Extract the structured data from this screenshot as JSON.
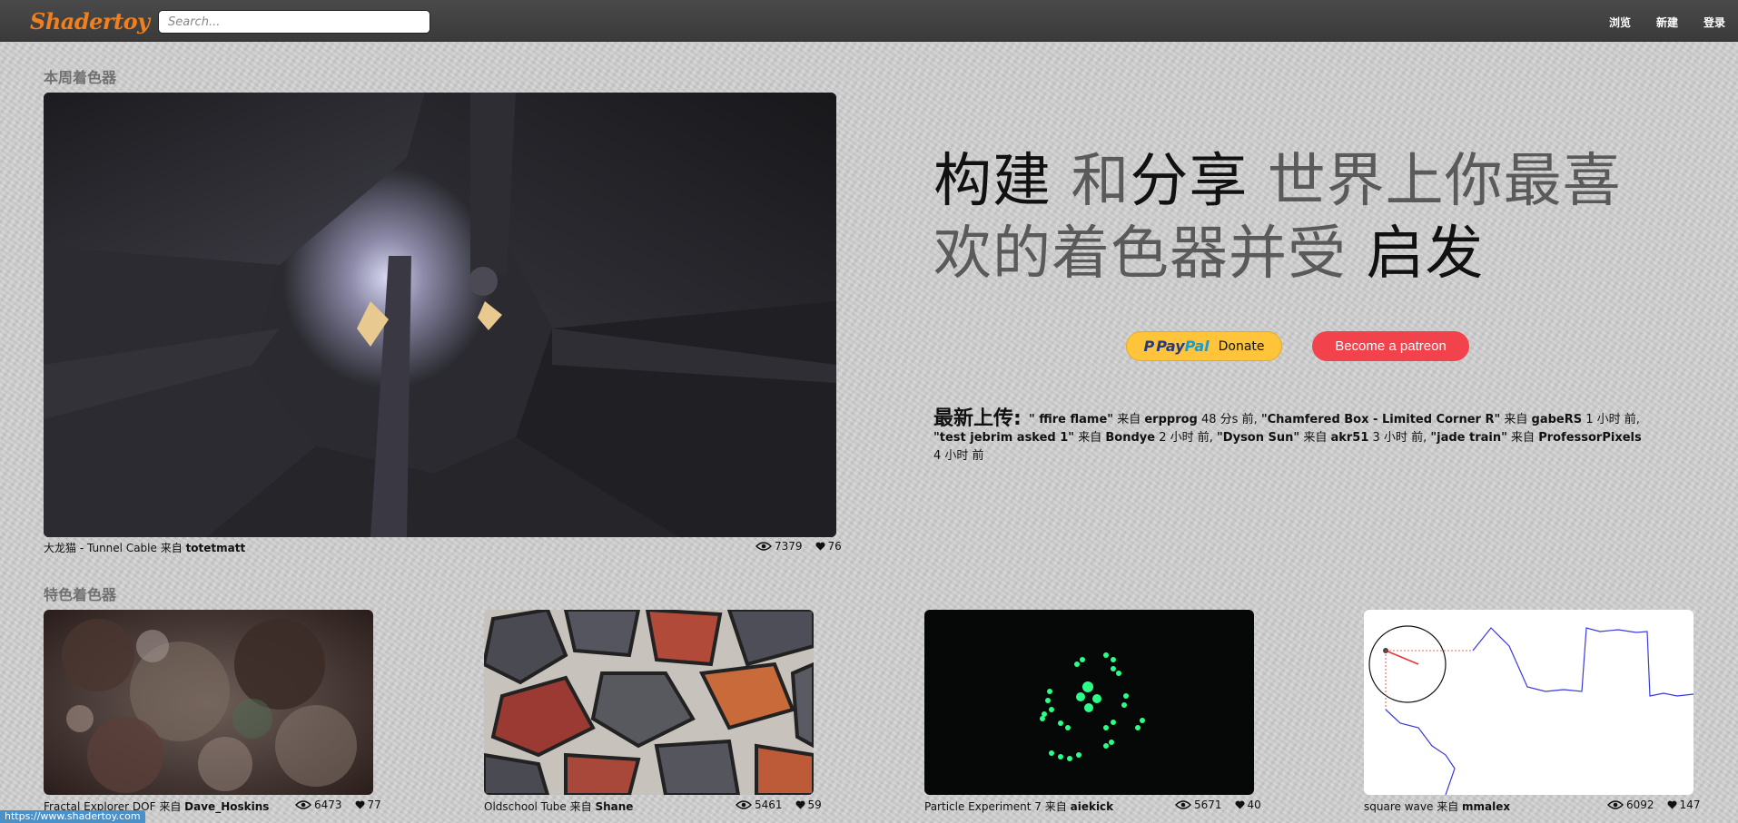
{
  "app": {
    "logo": "Shadertoy",
    "search_placeholder": "Search...",
    "nav": [
      "浏览",
      "新建",
      "登录"
    ]
  },
  "weekly": {
    "heading": "本周着色器",
    "shader": {
      "title": "大龙猫 - Tunnel Cable",
      "by": "来自",
      "author": "totetmatt",
      "views": "7379",
      "likes": "76"
    }
  },
  "hero": {
    "part1": "构建",
    "part2": " 和",
    "part3": "分享",
    "part4": " 世界上你最喜欢的着色器并受",
    "part5": " 启发"
  },
  "donate": {
    "paypal_p": "P",
    "paypal_pay": "Pay",
    "paypal_pal": "Pal",
    "paypal_label": "Donate",
    "patreon_label": "Become a patreon"
  },
  "latest": {
    "label": "最新上传:",
    "items": [
      {
        "title": "\" ffire flame\"",
        "by": "来自",
        "author": "erpprog",
        "time": "48 分s 前"
      },
      {
        "title": "\"Chamfered Box - Limited Corner R\"",
        "by": "来自",
        "author": "gabeRS",
        "time": "1 小时 前"
      },
      {
        "title": "\"test jebrim asked 1\"",
        "by": "来自",
        "author": "Bondye",
        "time": "2 小时 前"
      },
      {
        "title": "\"Dyson Sun\"",
        "by": "来自",
        "author": "akr51",
        "time": "3 小时 前"
      },
      {
        "title": "\"jade train\"",
        "by": "来自",
        "author": "ProfessorPixels",
        "time": "4 小时 前"
      }
    ]
  },
  "featured": {
    "heading": "特色着色器",
    "items": [
      {
        "title": "Fractal Explorer DOF",
        "by": "来自",
        "author": "Dave_Hoskins",
        "views": "6473",
        "likes": "77"
      },
      {
        "title": "Oldschool Tube",
        "by": "来自",
        "author": "Shane",
        "views": "5461",
        "likes": "59"
      },
      {
        "title": "Particle Experiment 7",
        "by": "来自",
        "author": "aiekick",
        "views": "5671",
        "likes": "40"
      },
      {
        "title": "square wave",
        "by": "来自",
        "author": "mmalex",
        "views": "6092",
        "likes": "147"
      }
    ]
  },
  "statusbar": {
    "url": "https://www.shadertoy.com"
  },
  "colors": {
    "accent": "#f07f1e",
    "patreon": "#f2424c",
    "paypal": "#ffc439"
  }
}
